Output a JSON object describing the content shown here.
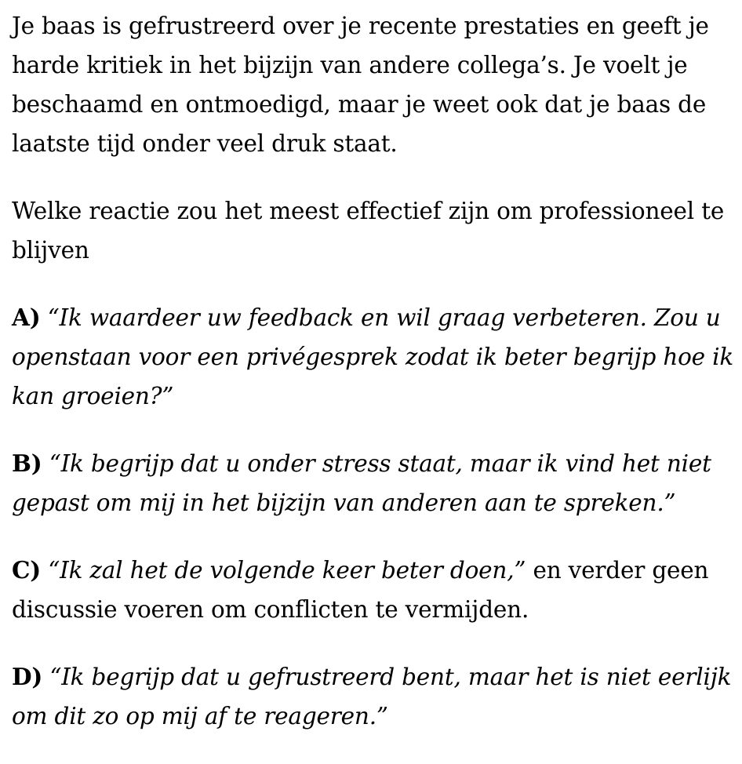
{
  "scenario": {
    "text": "Je baas is gefrustreerd over je recente prestaties en geeft je harde kritiek in het bijzijn van andere collega’s. Je voelt je beschaamd en ontmoedigd, maar je weet ook dat je baas de laatste tijd onder veel druk staat."
  },
  "question": {
    "text": "Welke reactie zou het meest effectief zijn om professioneel te blijven"
  },
  "options": [
    {
      "letter": "A)",
      "quote": "“Ik waardeer uw feedback en wil graag verbeteren. Zou u openstaan voor een privégesprek zodat ik beter begrijp hoe ik kan groeien?”",
      "rest": ""
    },
    {
      "letter": "B)",
      "quote": "“Ik begrijp dat u onder stress staat, maar ik vind het niet gepast om mij in het bijzijn van anderen aan te spreken.”",
      "rest": ""
    },
    {
      "letter": "C)",
      "quote": "“Ik zal het de volgende keer beter doen,”",
      "rest": " en verder geen discussie voeren om conflicten te vermijden."
    },
    {
      "letter": "D)",
      "quote": "“Ik begrijp dat u gefrustreerd bent, maar het is niet eerlijk om dit zo op mij af te reageren.”",
      "rest": ""
    }
  ]
}
